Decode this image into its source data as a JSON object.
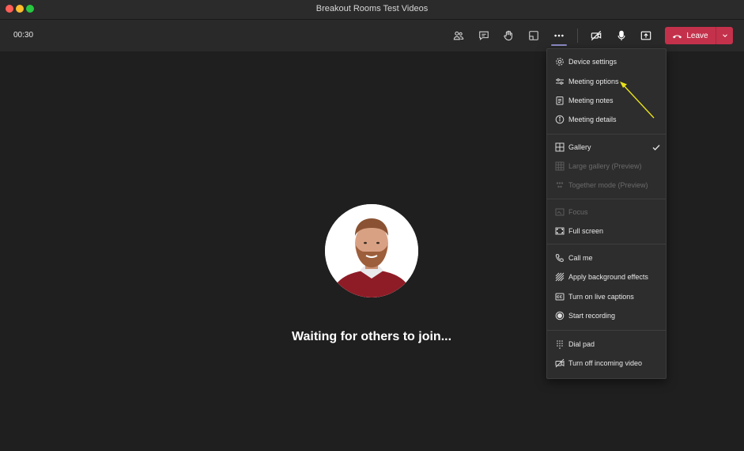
{
  "window": {
    "title": "Breakout Rooms Test Videos"
  },
  "toolbar": {
    "timer": "00:30",
    "leave_label": "Leave",
    "buttons": [
      "participants-icon",
      "chat-icon",
      "raise-hand-icon",
      "breakout-rooms-icon",
      "more-actions-icon",
      "camera-off-icon",
      "microphone-icon",
      "share-tray-icon"
    ]
  },
  "stage": {
    "waiting_text": "Waiting for others to join..."
  },
  "menu": {
    "items": [
      {
        "label": "Device settings",
        "icon": "gear-icon",
        "enabled": true
      },
      {
        "label": "Meeting options",
        "icon": "sliders-icon",
        "enabled": true
      },
      {
        "label": "Meeting notes",
        "icon": "notes-icon",
        "enabled": true
      },
      {
        "label": "Meeting details",
        "icon": "info-icon",
        "enabled": true
      },
      {
        "label": "Gallery",
        "icon": "gallery-icon",
        "enabled": true,
        "checked": true
      },
      {
        "label": "Large gallery (Preview)",
        "icon": "large-gallery-icon",
        "enabled": false
      },
      {
        "label": "Together mode (Preview)",
        "icon": "together-mode-icon",
        "enabled": false
      },
      {
        "label": "Focus",
        "icon": "focus-icon",
        "enabled": false
      },
      {
        "label": "Full screen",
        "icon": "fullscreen-icon",
        "enabled": true
      },
      {
        "label": "Call me",
        "icon": "phone-icon",
        "enabled": true
      },
      {
        "label": "Apply background effects",
        "icon": "background-effects-icon",
        "enabled": true
      },
      {
        "label": "Turn on live captions",
        "icon": "captions-icon",
        "enabled": true
      },
      {
        "label": "Start recording",
        "icon": "record-icon",
        "enabled": true
      },
      {
        "label": "Dial pad",
        "icon": "dialpad-icon",
        "enabled": true
      },
      {
        "label": "Turn off incoming video",
        "icon": "video-off-icon",
        "enabled": true
      }
    ]
  },
  "colors": {
    "leave_red": "#c4314b",
    "accent": "#8b8cc7",
    "annotation_arrow": "#e8e21a",
    "background": "#1f1f1f"
  }
}
